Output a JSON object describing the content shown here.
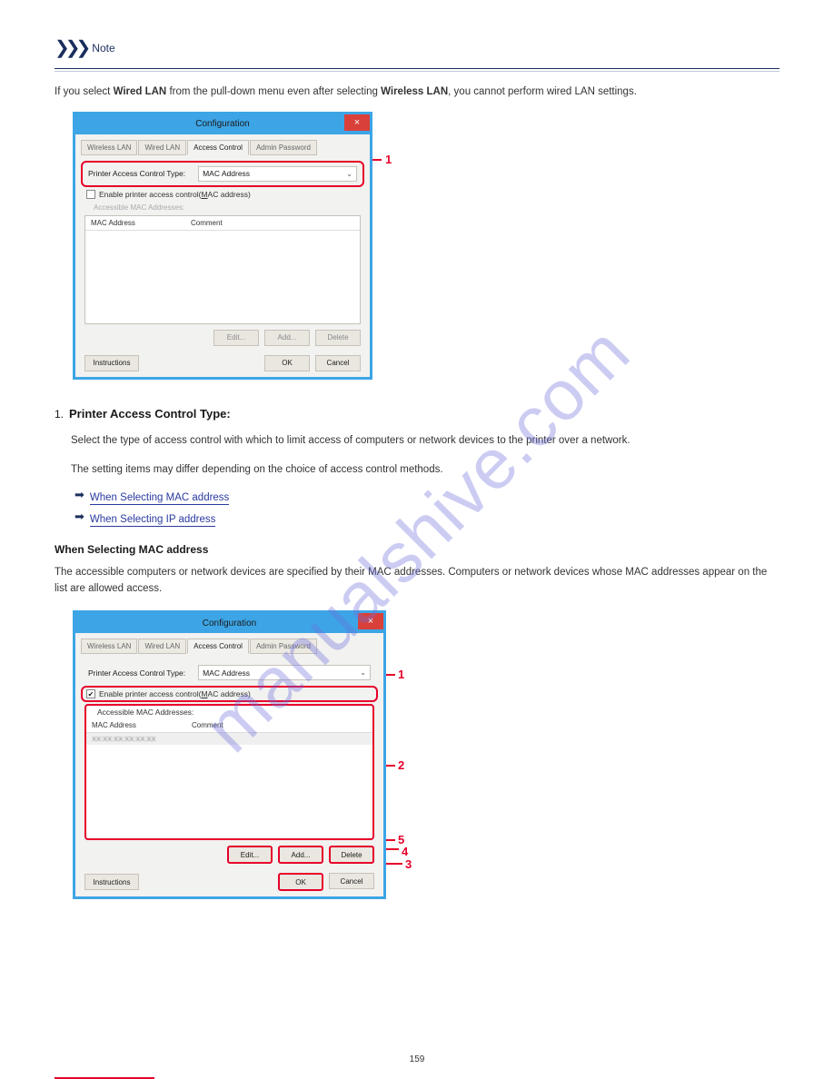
{
  "note": {
    "label": "Note"
  },
  "intro_para": {
    "prefix": "If you select ",
    "bold1": "Wired LAN",
    "mid": " from the pull-down menu even after selecting ",
    "bold2": "Wireless LAN",
    "suffix": ", you cannot perform wired LAN settings."
  },
  "section_num": "1.",
  "section_label": "Printer Access Control Type:",
  "section_desc": "Select the type of access control with which to limit access of computers or network devices to the printer over a network.",
  "section_desc2": "The setting items may differ depending on the choice of access control methods.",
  "link1": "When Selecting MAC address",
  "link2": "When Selecting IP address",
  "subheading": "When Selecting MAC address",
  "sub_desc": "The accessible computers or network devices are specified by their MAC addresses. Computers or network devices whose MAC addresses appear on the list are allowed access.",
  "window": {
    "title": "Configuration",
    "close": "×",
    "tabs": [
      "Wireless LAN",
      "Wired LAN",
      "Access Control",
      "Admin Password"
    ],
    "control_type_label": "Printer Access Control Type:",
    "control_type_value": "MAC Address",
    "enable_label_a": "Enable printer access control(",
    "enable_underline": "M",
    "enable_label_b": "AC address)",
    "group_label_disabled": "Accessible MAC Addresses:",
    "group_label_enabled": "Accessible MAC Addresses:",
    "col1": "MAC Address",
    "col2": "Comment",
    "row_sample": "XX:XX:XX:XX:XX:XX",
    "btn_edit": "Edit...",
    "btn_add": "Add...",
    "btn_delete": "Delete",
    "btn_instructions": "Instructions",
    "btn_ok": "OK",
    "btn_cancel": "Cancel"
  },
  "callouts": {
    "n1": "1",
    "n2": "2",
    "n3": "3",
    "n4": "4",
    "n5": "5"
  },
  "page_number": "159",
  "watermark": "manualshive.com"
}
